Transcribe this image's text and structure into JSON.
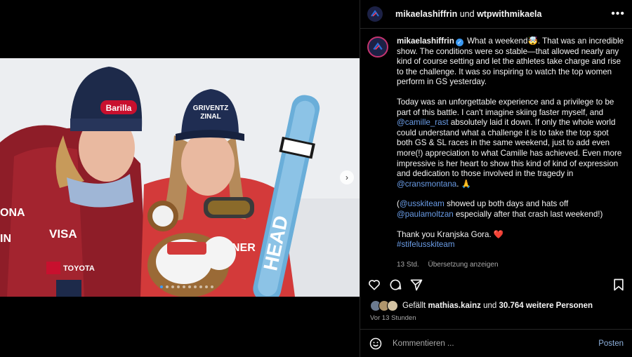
{
  "header": {
    "user1": "mikaelashiffrin",
    "joiner": "und",
    "user2": "wtpwithmikaela"
  },
  "post": {
    "author": "mikaelashiffrin",
    "paragraphs": [
      [
        {
          "t": "text",
          "v": " What a weekend"
        },
        {
          "t": "emoji",
          "v": "🤯"
        },
        {
          "t": "text",
          "v": ". That was an incredible show. The conditions were so stable—that allowed nearly any kind of course setting and let the athletes take charge and rise to the challenge. It was so inspiring to watch the top women perform in GS yesterday."
        }
      ],
      [
        {
          "t": "text",
          "v": "Today was an unforgettable experience and a privilege to be part of this battle. I can't imagine skiing faster myself, and "
        },
        {
          "t": "link",
          "v": "@camille_rast"
        },
        {
          "t": "text",
          "v": " absolutely laid it down. If only the whole world could understand what a challenge it is to take the top spot both GS & SL races in the same weekend, just to add even more(!) appreciation to what Camille has achieved. Even more impressive is her heart to show this kind of kind of expression and dedication to those involved in the tragedy in "
        },
        {
          "t": "link",
          "v": "@cransmontana"
        },
        {
          "t": "text",
          "v": ". 🙏"
        }
      ],
      [
        {
          "t": "text",
          "v": "("
        },
        {
          "t": "link",
          "v": "@usskiteam"
        },
        {
          "t": "text",
          "v": " showed up both days and hats off "
        },
        {
          "t": "link",
          "v": "@paulamoltzan"
        },
        {
          "t": "text",
          "v": " especially after that crash last weekend!)"
        }
      ],
      [
        {
          "t": "text",
          "v": "Thank you Kranjska Gora. ❤️"
        },
        {
          "t": "br",
          "v": ""
        },
        {
          "t": "link",
          "v": "#stifelusskiteam"
        }
      ]
    ],
    "age": "13 Std.",
    "translate_label": "Übersetzung anzeigen"
  },
  "likes": {
    "prefix": "Gefällt",
    "user": "mathias.kainz",
    "joiner": "und",
    "count_text": "30.764 weitere Personen"
  },
  "timestamp": "Vor 13 Stunden",
  "comment": {
    "placeholder": "Kommentieren ...",
    "post_label": "Posten"
  },
  "carousel": {
    "count": 10,
    "active_index": 0
  },
  "colors": {
    "link": "#6a9ce6",
    "verified": "#3897f0",
    "ring": "#c5346f",
    "post": "#8fb2de"
  }
}
